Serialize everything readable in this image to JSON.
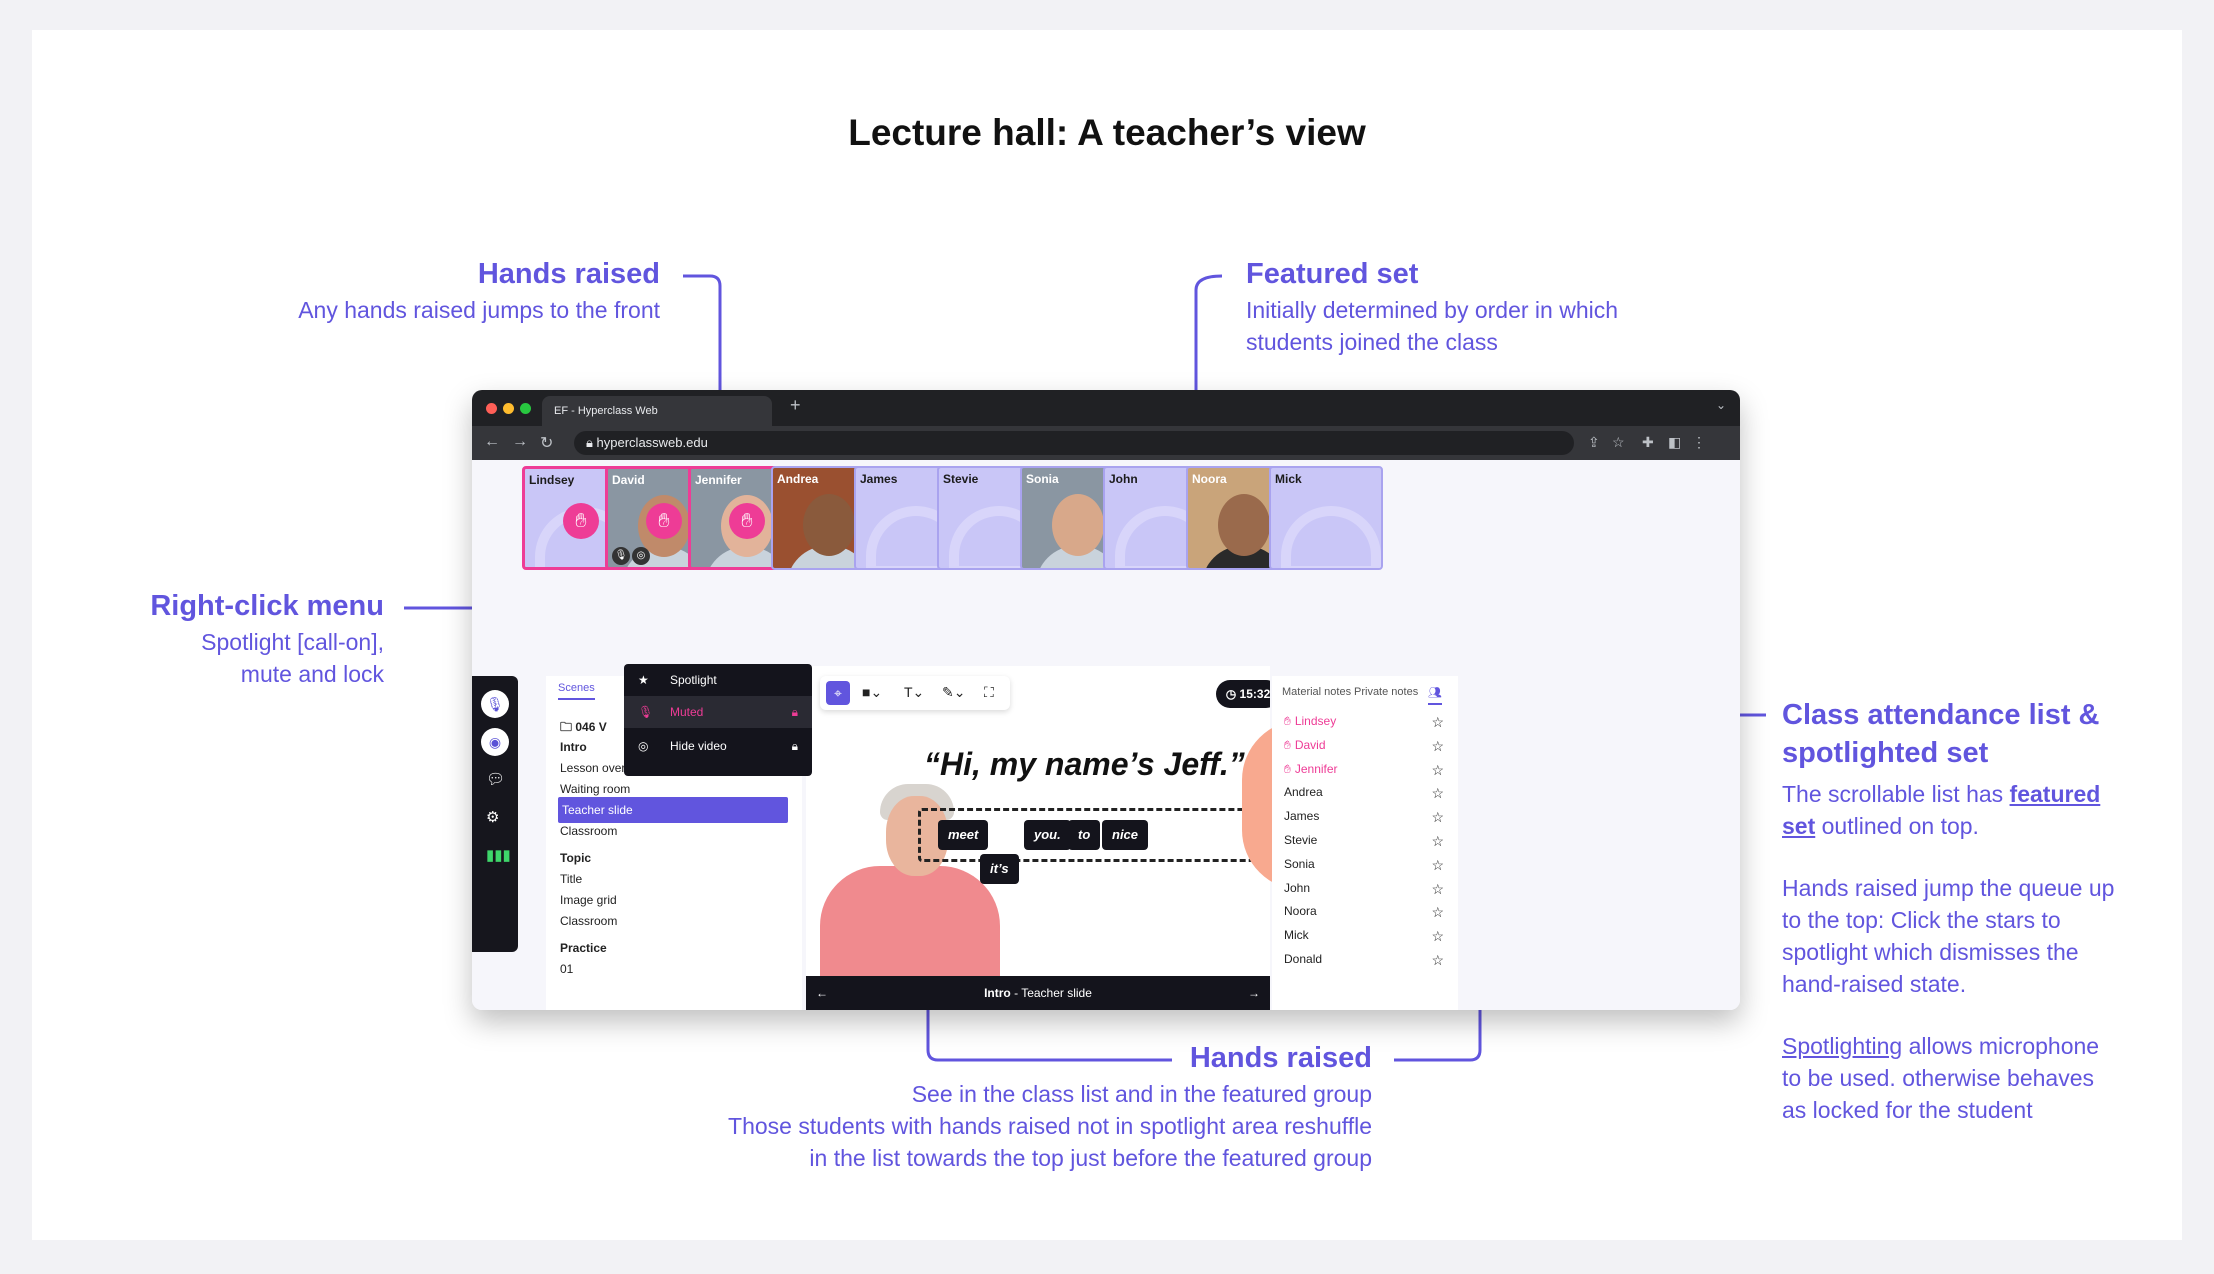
{
  "page": {
    "title": "Lecture hall: A teacher’s view"
  },
  "annotations": {
    "hands_raised_top": {
      "heading": "Hands raised",
      "text": "Any hands raised jumps to the front"
    },
    "featured_set": {
      "heading": "Featured set",
      "lines": [
        "Initially determined by order in which",
        "students joined the class"
      ]
    },
    "right_click": {
      "heading": "Right-click menu",
      "lines": [
        "Spotlight [call-on],",
        "mute and lock"
      ]
    },
    "class_attendance": {
      "heading_lines": [
        "Class attendance list &",
        "spotlighted set"
      ],
      "p1_a": "The scrollable list has ",
      "p1_link1": "featured",
      "p1_link2": "set",
      "p1_b": " outlined on top.",
      "p2": [
        "Hands raised jump the queue up",
        "to the top: Click the stars to",
        "spotlight which dismisses the",
        "hand-raised state."
      ],
      "p3_link": "Spotlighting",
      "p3_a": " allows microphone",
      "p3_rest": [
        "to be used. otherwise behaves",
        "as locked for the student"
      ]
    },
    "hands_raised_bottom": {
      "heading": "Hands raised",
      "lines": [
        "See in the class list and in the featured group",
        "Those students with hands raised not in spotlight area reshuffle",
        "in the list towards the top just before the featured group"
      ]
    }
  },
  "browser": {
    "tab_title": "EF - Hyperclass Web",
    "url": "hyperclassweb.edu",
    "colors": {
      "chrome": "#202124",
      "accent": "#6155de",
      "hand": "#ee3c96"
    }
  },
  "tiles": [
    {
      "name": "Lindsey",
      "hand": true,
      "photo": false
    },
    {
      "name": "David",
      "hand": true,
      "photo": true
    },
    {
      "name": "Jennifer",
      "hand": true,
      "photo": true
    },
    {
      "name": "Andrea",
      "hand": false,
      "photo": true
    },
    {
      "name": "James",
      "hand": false,
      "photo": false
    },
    {
      "name": "Stevie",
      "hand": false,
      "photo": false
    },
    {
      "name": "Sonia",
      "hand": false,
      "photo": true
    },
    {
      "name": "John",
      "hand": false,
      "photo": false
    },
    {
      "name": "Noora",
      "hand": false,
      "photo": true
    },
    {
      "name": "Mick",
      "hand": false,
      "photo": false
    }
  ],
  "context_menu": {
    "items": [
      {
        "label": "Spotlight",
        "icon": "star-icon"
      },
      {
        "label": "Muted",
        "icon": "mic-off-icon",
        "locked": true
      },
      {
        "label": "Hide video",
        "icon": "camera-off-icon",
        "locked": true
      }
    ]
  },
  "scenes": {
    "tab": "Scenes",
    "folder": "046 V",
    "items": [
      {
        "label": "Intro",
        "heading": true
      },
      {
        "label": "Lesson overview"
      },
      {
        "label": "Waiting room"
      },
      {
        "label": "Teacher slide",
        "selected": true
      },
      {
        "label": "Classroom"
      },
      {
        "label": "Topic",
        "heading": true
      },
      {
        "label": "Title"
      },
      {
        "label": "Image grid"
      },
      {
        "label": "Classroom"
      },
      {
        "label": "Practice",
        "heading": true
      },
      {
        "label": "01"
      }
    ]
  },
  "slide": {
    "timer": "15:32",
    "quote": "“Hi, my name’s Jeff.”",
    "chips": [
      "meet",
      "you.",
      "to",
      "nice",
      "it’s"
    ],
    "footer_bold": "Intro",
    "footer_rest": " - Teacher slide"
  },
  "attendance": {
    "tabs": [
      "Material notes",
      "Private notes"
    ],
    "students": [
      {
        "name": "Lindsey",
        "hand": true
      },
      {
        "name": "David",
        "hand": true
      },
      {
        "name": "Jennifer",
        "hand": true
      },
      {
        "name": "Andrea"
      },
      {
        "name": "James"
      },
      {
        "name": "Stevie"
      },
      {
        "name": "Sonia"
      },
      {
        "name": "John"
      },
      {
        "name": "Noora"
      },
      {
        "name": "Mick"
      },
      {
        "name": "Donald"
      }
    ]
  }
}
